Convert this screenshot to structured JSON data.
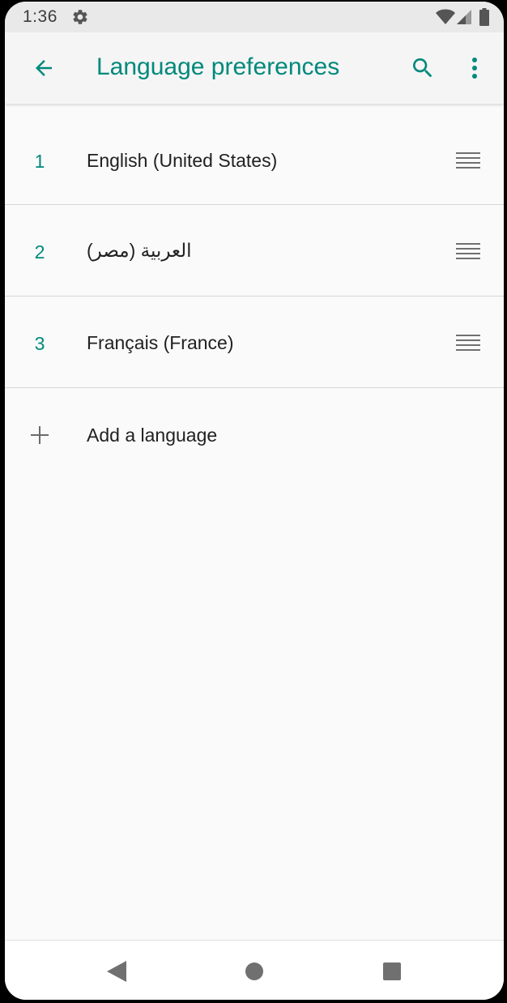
{
  "status_bar": {
    "time": "1:36",
    "icons": [
      "settings-gear-icon",
      "wifi-icon",
      "cellular-signal-icon",
      "battery-icon"
    ]
  },
  "app_bar": {
    "title": "Language preferences",
    "back_icon": "arrow-back-icon",
    "search_icon": "search-icon",
    "more_icon": "more-vert-icon"
  },
  "languages": [
    {
      "number": "1",
      "label": "English (United States)",
      "drag_icon": "drag-handle-icon"
    },
    {
      "number": "2",
      "label": "العربية (مصر)",
      "drag_icon": "drag-handle-icon"
    },
    {
      "number": "3",
      "label": "Français (France)",
      "drag_icon": "drag-handle-icon"
    }
  ],
  "add_language": {
    "label": "Add a language",
    "icon": "plus-icon"
  },
  "nav_bar": {
    "icons": [
      "nav-back-icon",
      "nav-home-icon",
      "nav-recents-icon"
    ]
  },
  "colors": {
    "accent": "#00897b",
    "text_primary": "#212121",
    "background": "#fafafa",
    "status_bar": "#e9e9e9"
  }
}
